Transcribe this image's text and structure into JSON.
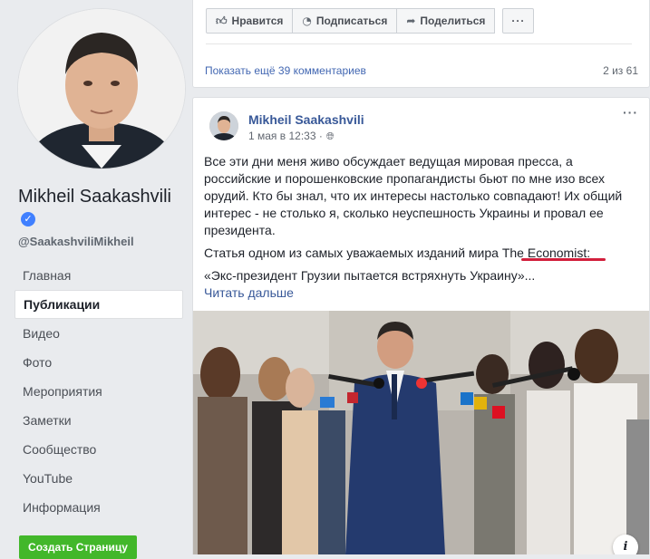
{
  "profile": {
    "name": "Mikheil Saakashvili",
    "handle": "@SaakashviliMikheil",
    "verified_glyph": "✓"
  },
  "nav": {
    "items": [
      {
        "label": "Главная",
        "active": false
      },
      {
        "label": "Публикации",
        "active": true
      },
      {
        "label": "Видео",
        "active": false
      },
      {
        "label": "Фото",
        "active": false
      },
      {
        "label": "Мероприятия",
        "active": false
      },
      {
        "label": "Заметки",
        "active": false
      },
      {
        "label": "Сообщество",
        "active": false
      },
      {
        "label": "YouTube",
        "active": false
      },
      {
        "label": "Информация",
        "active": false
      }
    ]
  },
  "create_page_button": "Создать Страницу",
  "toolbar": {
    "like_label": "Нравится",
    "subscribe_label": "Подписаться",
    "share_label": "Поделиться",
    "more_label": "···"
  },
  "comments": {
    "show_more": "Показать ещё 39 комментариев",
    "count": "2 из 61"
  },
  "post": {
    "author": "Mikheil Saakashvili",
    "date": "1 мая в 12:33 ·",
    "menu": "···",
    "paragraph1": "Все эти дни меня живо обсуждает ведущая мировая пресса, а российские и порошенковские пропагандисты бьют по мне изо всех орудий. Кто бы знал, что их интересы настолько совпадают! Их общий интерес - не столько я, сколько неуспешность Украины и провал ее президента.",
    "paragraph2_prefix": "Статья одном из самых уважаемых изданий мира ",
    "paragraph2_link": "The Economist:",
    "paragraph3": "«Экс-президент Грузии пытается встряхнуть Украину»...",
    "read_more": "Читать дальше",
    "info_glyph": "i"
  },
  "colors": {
    "brand_blue": "#385898",
    "link_blue": "#4267b2",
    "green": "#42b72a",
    "underline_red": "#d21f3c"
  }
}
